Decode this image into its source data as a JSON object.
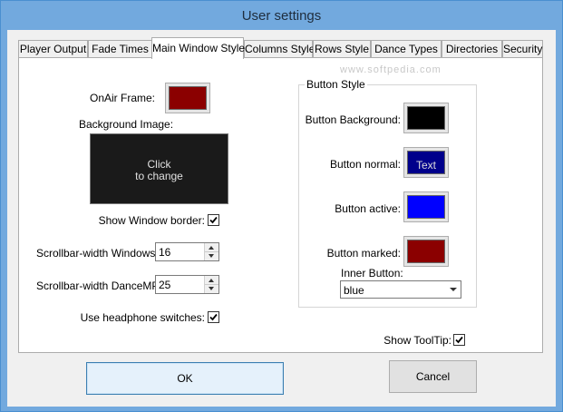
{
  "window": {
    "title": "User settings"
  },
  "tabs": [
    {
      "label": "Player Output",
      "active": false
    },
    {
      "label": "Fade Times",
      "active": false
    },
    {
      "label": "Main Window Style",
      "active": true
    },
    {
      "label": "Columns Style",
      "active": false
    },
    {
      "label": "Rows Style",
      "active": false
    },
    {
      "label": "Dance Types",
      "active": false
    },
    {
      "label": "Directories",
      "active": false
    },
    {
      "label": "Security",
      "active": false
    }
  ],
  "watermark": "www.softpedia.com",
  "main": {
    "onair_frame": {
      "label": "OnAir Frame:",
      "color": "#8b0000"
    },
    "background_image": {
      "label": "Background Image:",
      "text_line1": "Click",
      "text_line2": "to change"
    },
    "show_window_border": {
      "label": "Show Window border:",
      "checked": true
    },
    "scrollbar_windows": {
      "label": "Scrollbar-width Windows :",
      "value": "16"
    },
    "scrollbar_dancemp": {
      "label": "Scrollbar-width DanceMP:",
      "value": "25"
    },
    "headphone_switches": {
      "label": "Use headphone switches:",
      "checked": true
    }
  },
  "button_style": {
    "legend": "Button Style",
    "background": {
      "label": "Button Background:",
      "color": "#000000"
    },
    "normal": {
      "label": "Button normal:",
      "color": "#00008b",
      "text": "Text"
    },
    "active": {
      "label": "Button active:",
      "color": "#0000ff"
    },
    "marked": {
      "label": "Button marked:",
      "color": "#8b0000"
    },
    "inner_button": {
      "label": "Inner Button:",
      "value": "blue"
    },
    "show_tooltip": {
      "label": "Show ToolTip:",
      "checked": true
    }
  },
  "footer": {
    "ok_label": "OK",
    "cancel_label": "Cancel"
  }
}
